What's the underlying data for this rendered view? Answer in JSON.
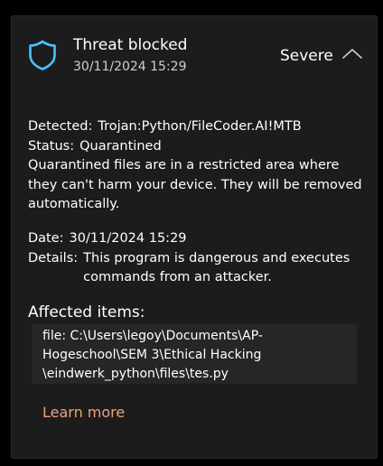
{
  "notification": {
    "title": "Threat blocked",
    "timestamp": "30/11/2024 15:29",
    "severity": "Severe",
    "icon": "shield-icon",
    "chevron": "chevron-up-icon"
  },
  "details": {
    "detected_label": "Detected:",
    "detected_value": "Trojan:Python/FileCoder.AI!MTB",
    "status_label": "Status:",
    "status_value": "Quarantined",
    "description": "Quarantined files are in a restricted area where they can't harm your device. They will be removed automatically.",
    "date_label": "Date:",
    "date_value": "30/11/2024 15:29",
    "details_label": "Details:",
    "details_value": "This program is dangerous and executes commands from an attacker."
  },
  "affected": {
    "heading": "Affected items:",
    "file_line_1": "file: C:\\Users\\legoy\\Documents\\AP-",
    "file_line_2": "Hogeschool\\SEM 3\\Ethical Hacking",
    "file_line_3": "\\eindwerk_python\\files\\tes.py"
  },
  "actions": {
    "learn_more": "Learn more"
  },
  "colors": {
    "background": "#000000",
    "panel": "#1c1c1c",
    "shield": "#4cc2ff",
    "link": "#f0a27d"
  }
}
